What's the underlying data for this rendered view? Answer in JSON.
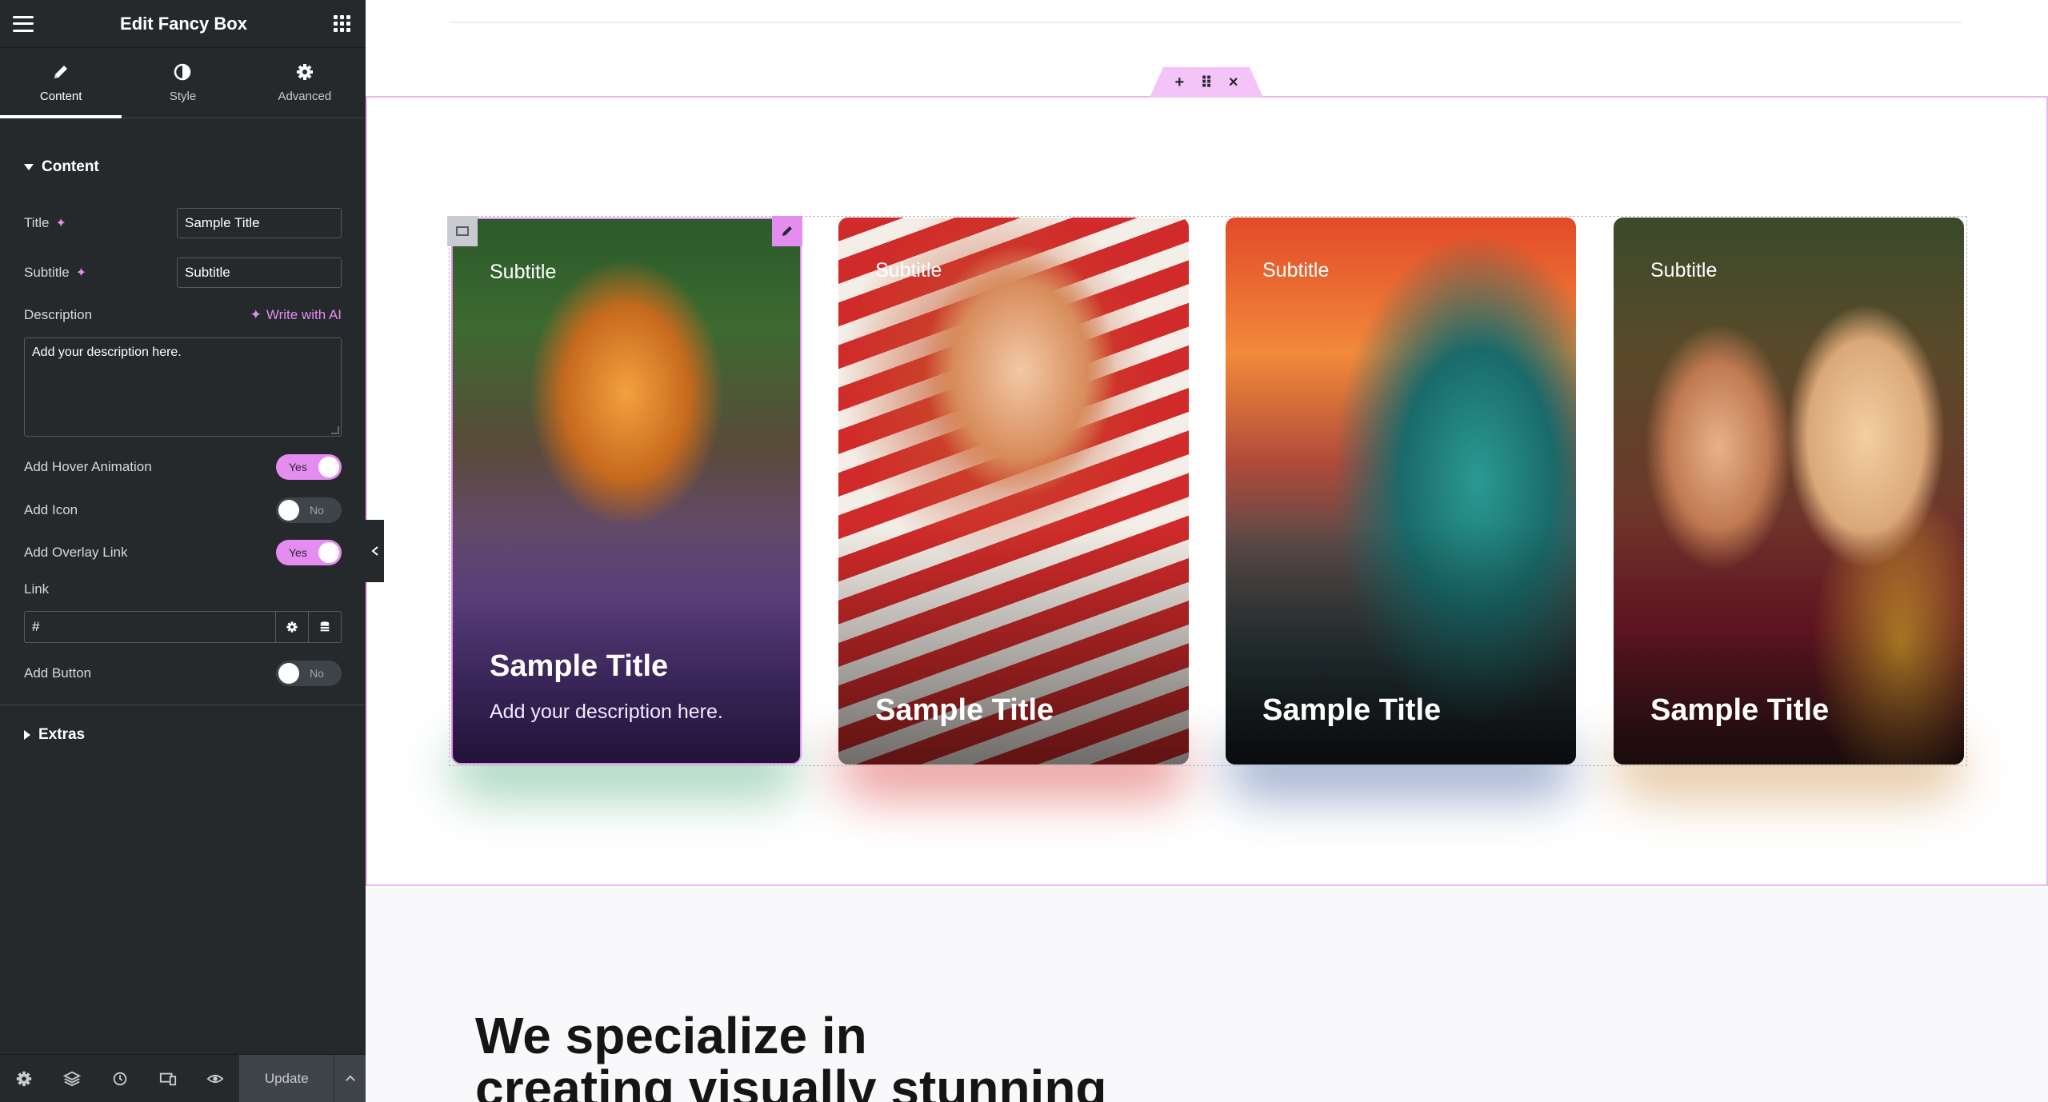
{
  "sidebar": {
    "header": {
      "title": "Edit Fancy Box"
    },
    "tabs": [
      {
        "label": "Content"
      },
      {
        "label": "Style"
      },
      {
        "label": "Advanced"
      }
    ],
    "content_section": {
      "title": "Content",
      "title_field": {
        "label": "Title",
        "value": "Sample Title"
      },
      "subtitle_field": {
        "label": "Subtitle",
        "value": "Subtitle"
      },
      "description": {
        "label": "Description",
        "ai_link": "Write with AI",
        "value": "Add your description here."
      },
      "hover_animation": {
        "label": "Add Hover Animation",
        "state": "Yes"
      },
      "add_icon": {
        "label": "Add Icon",
        "state": "No"
      },
      "overlay_link": {
        "label": "Add Overlay Link",
        "state": "Yes"
      },
      "link": {
        "label": "Link",
        "value": "#"
      },
      "add_button": {
        "label": "Add Button",
        "state": "No"
      }
    },
    "extras_section": {
      "title": "Extras"
    },
    "footer": {
      "update_label": "Update"
    }
  },
  "canvas": {
    "section_handle": {
      "add": "+",
      "move": "⠿",
      "close": "×"
    },
    "cards": [
      {
        "subtitle": "Subtitle",
        "title": "Sample Title",
        "description": "Add your description here."
      },
      {
        "subtitle": "Subtitle",
        "title": "Sample Title"
      },
      {
        "subtitle": "Subtitle",
        "title": "Sample Title"
      },
      {
        "subtitle": "Subtitle",
        "title": "Sample Title"
      }
    ],
    "headline_line1": "We specialize in",
    "headline_line2": "creating visually stunning"
  },
  "colors": {
    "accent": "#e58cf0",
    "sidebar_bg": "#26292c",
    "section_outline": "#e9b6ef"
  }
}
